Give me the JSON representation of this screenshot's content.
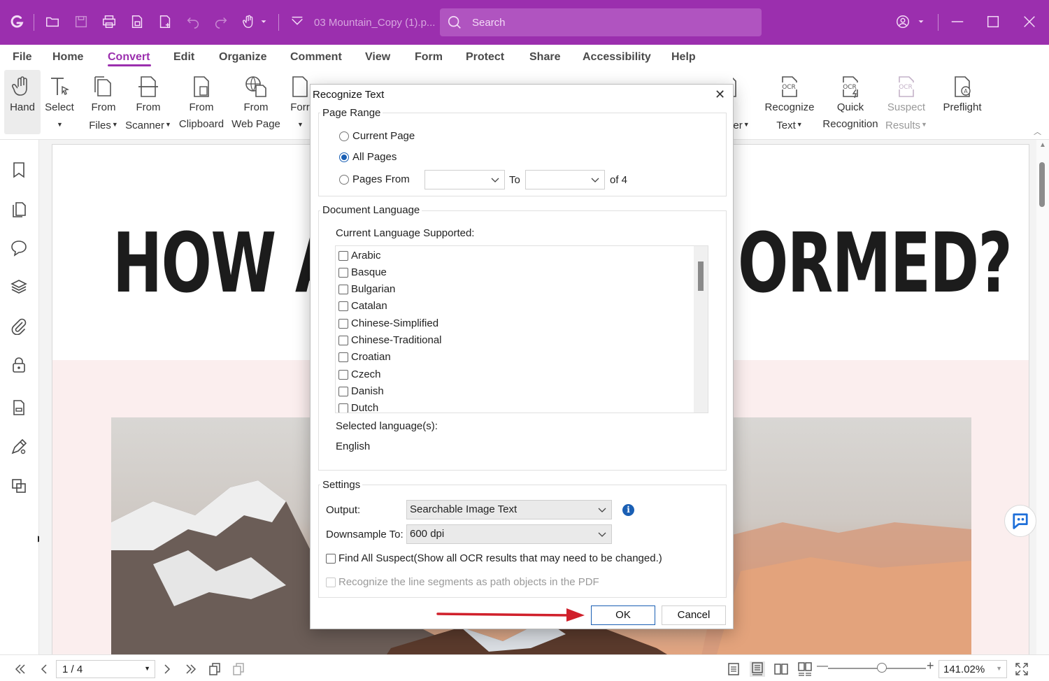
{
  "titlebar": {
    "filename": "03 Mountain_Copy (1).p...",
    "search_placeholder": "Search"
  },
  "menu": [
    "File",
    "Home",
    "Convert",
    "Edit",
    "Organize",
    "Comment",
    "View",
    "Form",
    "Protect",
    "Share",
    "Accessibility",
    "Help"
  ],
  "ribbon": {
    "hand": "Hand",
    "select": "Select",
    "from_files": [
      "From",
      "Files"
    ],
    "from_scanner": [
      "From",
      "Scanner"
    ],
    "from_clipboard": [
      "From",
      "Clipboard"
    ],
    "from_web": [
      "From",
      "Web Page"
    ],
    "form_partial": "Forr",
    "partial_er": "er",
    "recognize_text": [
      "Recognize",
      "Text"
    ],
    "quick_recognition": [
      "Quick",
      "Recognition"
    ],
    "suspect_results": [
      "Suspect",
      "Results"
    ],
    "preflight": "Preflight"
  },
  "document": {
    "heading_left": "HOW AR",
    "heading_right": "ORMED?"
  },
  "dialog": {
    "title": "Recognize Text",
    "page_range": {
      "label": "Page Range",
      "current_page": "Current Page",
      "all_pages": "All Pages",
      "pages_from": "Pages From",
      "to": "To",
      "of": "of 4",
      "selected": "all_pages"
    },
    "document_language": {
      "label": "Document Language",
      "supported_label": "Current Language Supported:",
      "languages": [
        "Arabic",
        "Basque",
        "Bulgarian",
        "Catalan",
        "Chinese-Simplified",
        "Chinese-Traditional",
        "Croatian",
        "Czech",
        "Danish",
        "Dutch"
      ],
      "selected_label": "Selected language(s):",
      "selected_value": "English"
    },
    "settings": {
      "label": "Settings",
      "output_label": "Output:",
      "output_value": "Searchable Image Text",
      "downsample_label": "Downsample To:",
      "downsample_value": "600 dpi",
      "find_suspect": "Find All Suspect(Show all OCR results that may need to be changed.)",
      "line_segments": "Recognize the line segments as path objects in the PDF"
    },
    "ok": "OK",
    "cancel": "Cancel"
  },
  "bottombar": {
    "page": "1 / 4",
    "zoom": "141.02%"
  },
  "colors": {
    "brand": "#9b2fae",
    "accent": "#1a5fb4",
    "arrow": "#d0202b"
  }
}
